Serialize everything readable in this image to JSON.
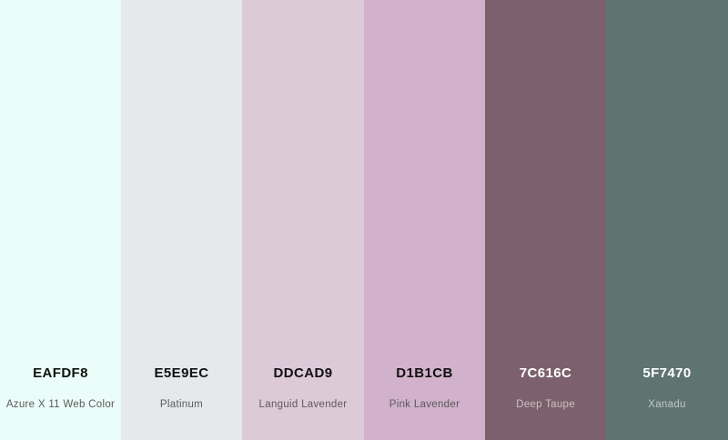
{
  "swatches": [
    {
      "hex": "EAFDF8",
      "name": "Azure X 11 Web Color",
      "color": "#EAFDF8",
      "tone": "light"
    },
    {
      "hex": "E5E9EC",
      "name": "Platinum",
      "color": "#E5E9EC",
      "tone": "light"
    },
    {
      "hex": "DDCAD9",
      "name": "Languid Lavender",
      "color": "#DDCAD9",
      "tone": "light"
    },
    {
      "hex": "D1B1CB",
      "name": "Pink Lavender",
      "color": "#D1B1CB",
      "tone": "light"
    },
    {
      "hex": "7C616C",
      "name": "Deep Taupe",
      "color": "#7C616C",
      "tone": "dark"
    },
    {
      "hex": "5F7470",
      "name": "Xanadu",
      "color": "#5F7470",
      "tone": "dark"
    }
  ]
}
